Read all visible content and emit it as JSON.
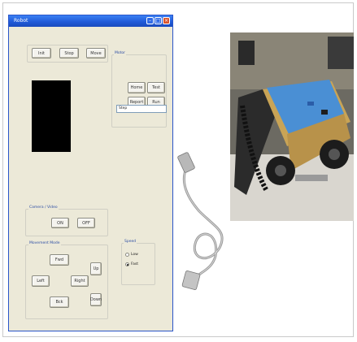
{
  "window": {
    "title": "Robot"
  },
  "top_buttons": [
    "Init",
    "Stop",
    "Move"
  ],
  "motor_group": {
    "label": "Motor",
    "buttons": [
      "Home",
      "Test",
      "Report",
      "Run"
    ],
    "input_value": "Step"
  },
  "camera_group": {
    "label": "Camera / Video",
    "buttons": [
      "ON",
      "OFF"
    ]
  },
  "movement_group": {
    "label": "Movement Mode",
    "buttons": {
      "forward": "Fwd",
      "left": "Left",
      "right": "Right",
      "back": "Bck",
      "up": "Up",
      "down": "Down"
    }
  },
  "speed_group": {
    "label": "Speed",
    "options": [
      {
        "label": "Low",
        "checked": false
      },
      {
        "label": "Fast",
        "checked": true
      }
    ]
  },
  "colors": {
    "accent": "#2a55c9",
    "window_bg": "#ece9d8"
  }
}
